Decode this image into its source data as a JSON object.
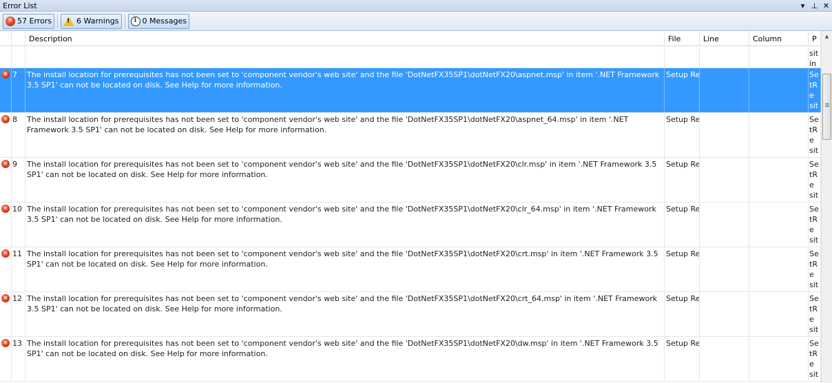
{
  "window": {
    "title": "Error List",
    "dropdown_icon": "chevron-down-icon",
    "pin_icon": "pin-icon",
    "close_icon": "close-icon"
  },
  "toolbar": {
    "errors_label": "57 Errors",
    "warnings_label": "6 Warnings",
    "messages_label": "0 Messages"
  },
  "columns": {
    "description": "Description",
    "file": "File",
    "line": "Line",
    "column": "Column",
    "project": "P"
  },
  "partial_row": {
    "project": "sitin"
  },
  "rows": [
    {
      "num": "7",
      "description": "The install location for prerequisites has not been set to 'component vendor's web site' and the file 'DotNetFX35SP1\\dotNetFX20\\aspnet.msp' in item '.NET Framework 3.5 SP1' can not be located on disk. See Help for more information.",
      "file": "Setup Re",
      "line": "",
      "column": "",
      "project": "SetRe sition",
      "selected": true
    },
    {
      "num": "8",
      "description": "The install location for prerequisites has not been set to 'component vendor's web site' and the file 'DotNetFX35SP1\\dotNetFX20\\aspnet_64.msp' in item '.NET Framework 3.5 SP1' can not be located on disk. See Help for more information.",
      "file": "Setup Re",
      "line": "",
      "column": "",
      "project": "SetRe sition",
      "selected": false
    },
    {
      "num": "9",
      "description": "The install location for prerequisites has not been set to 'component vendor's web site' and the file 'DotNetFX35SP1\\dotNetFX20\\clr.msp' in item '.NET Framework 3.5 SP1' can not be located on disk. See Help for more information.",
      "file": "Setup Re",
      "line": "",
      "column": "",
      "project": "SetRe sition",
      "selected": false
    },
    {
      "num": "10",
      "description": "The install location for prerequisites has not been set to 'component vendor's web site' and the file 'DotNetFX35SP1\\dotNetFX20\\clr_64.msp' in item '.NET Framework 3.5 SP1' can not be located on disk. See Help for more information.",
      "file": "Setup Re",
      "line": "",
      "column": "",
      "project": "SetRe sition",
      "selected": false
    },
    {
      "num": "11",
      "description": "The install location for prerequisites has not been set to 'component vendor's web site' and the file 'DotNetFX35SP1\\dotNetFX20\\crt.msp' in item '.NET Framework 3.5 SP1' can not be located on disk. See Help for more information.",
      "file": "Setup Re",
      "line": "",
      "column": "",
      "project": "SetRe sition",
      "selected": false
    },
    {
      "num": "12",
      "description": "The install location for prerequisites has not been set to 'component vendor's web site' and the file 'DotNetFX35SP1\\dotNetFX20\\crt_64.msp' in item '.NET Framework 3.5 SP1' can not be located on disk. See Help for more information.",
      "file": "Setup Re",
      "line": "",
      "column": "",
      "project": "SetRe sition",
      "selected": false
    },
    {
      "num": "13",
      "description": "The install location for prerequisites has not been set to 'component vendor's web site' and the file 'DotNetFX35SP1\\dotNetFX20\\dw.msp' in item '.NET Framework 3.5 SP1' can not be located on disk. See Help for more information.",
      "file": "Setup Re",
      "line": "",
      "column": "",
      "project": "SetRe sition",
      "selected": false
    }
  ],
  "colors": {
    "selected_row": "#3399ff",
    "error_icon": "#d6391b",
    "warning_icon": "#f2c219"
  }
}
